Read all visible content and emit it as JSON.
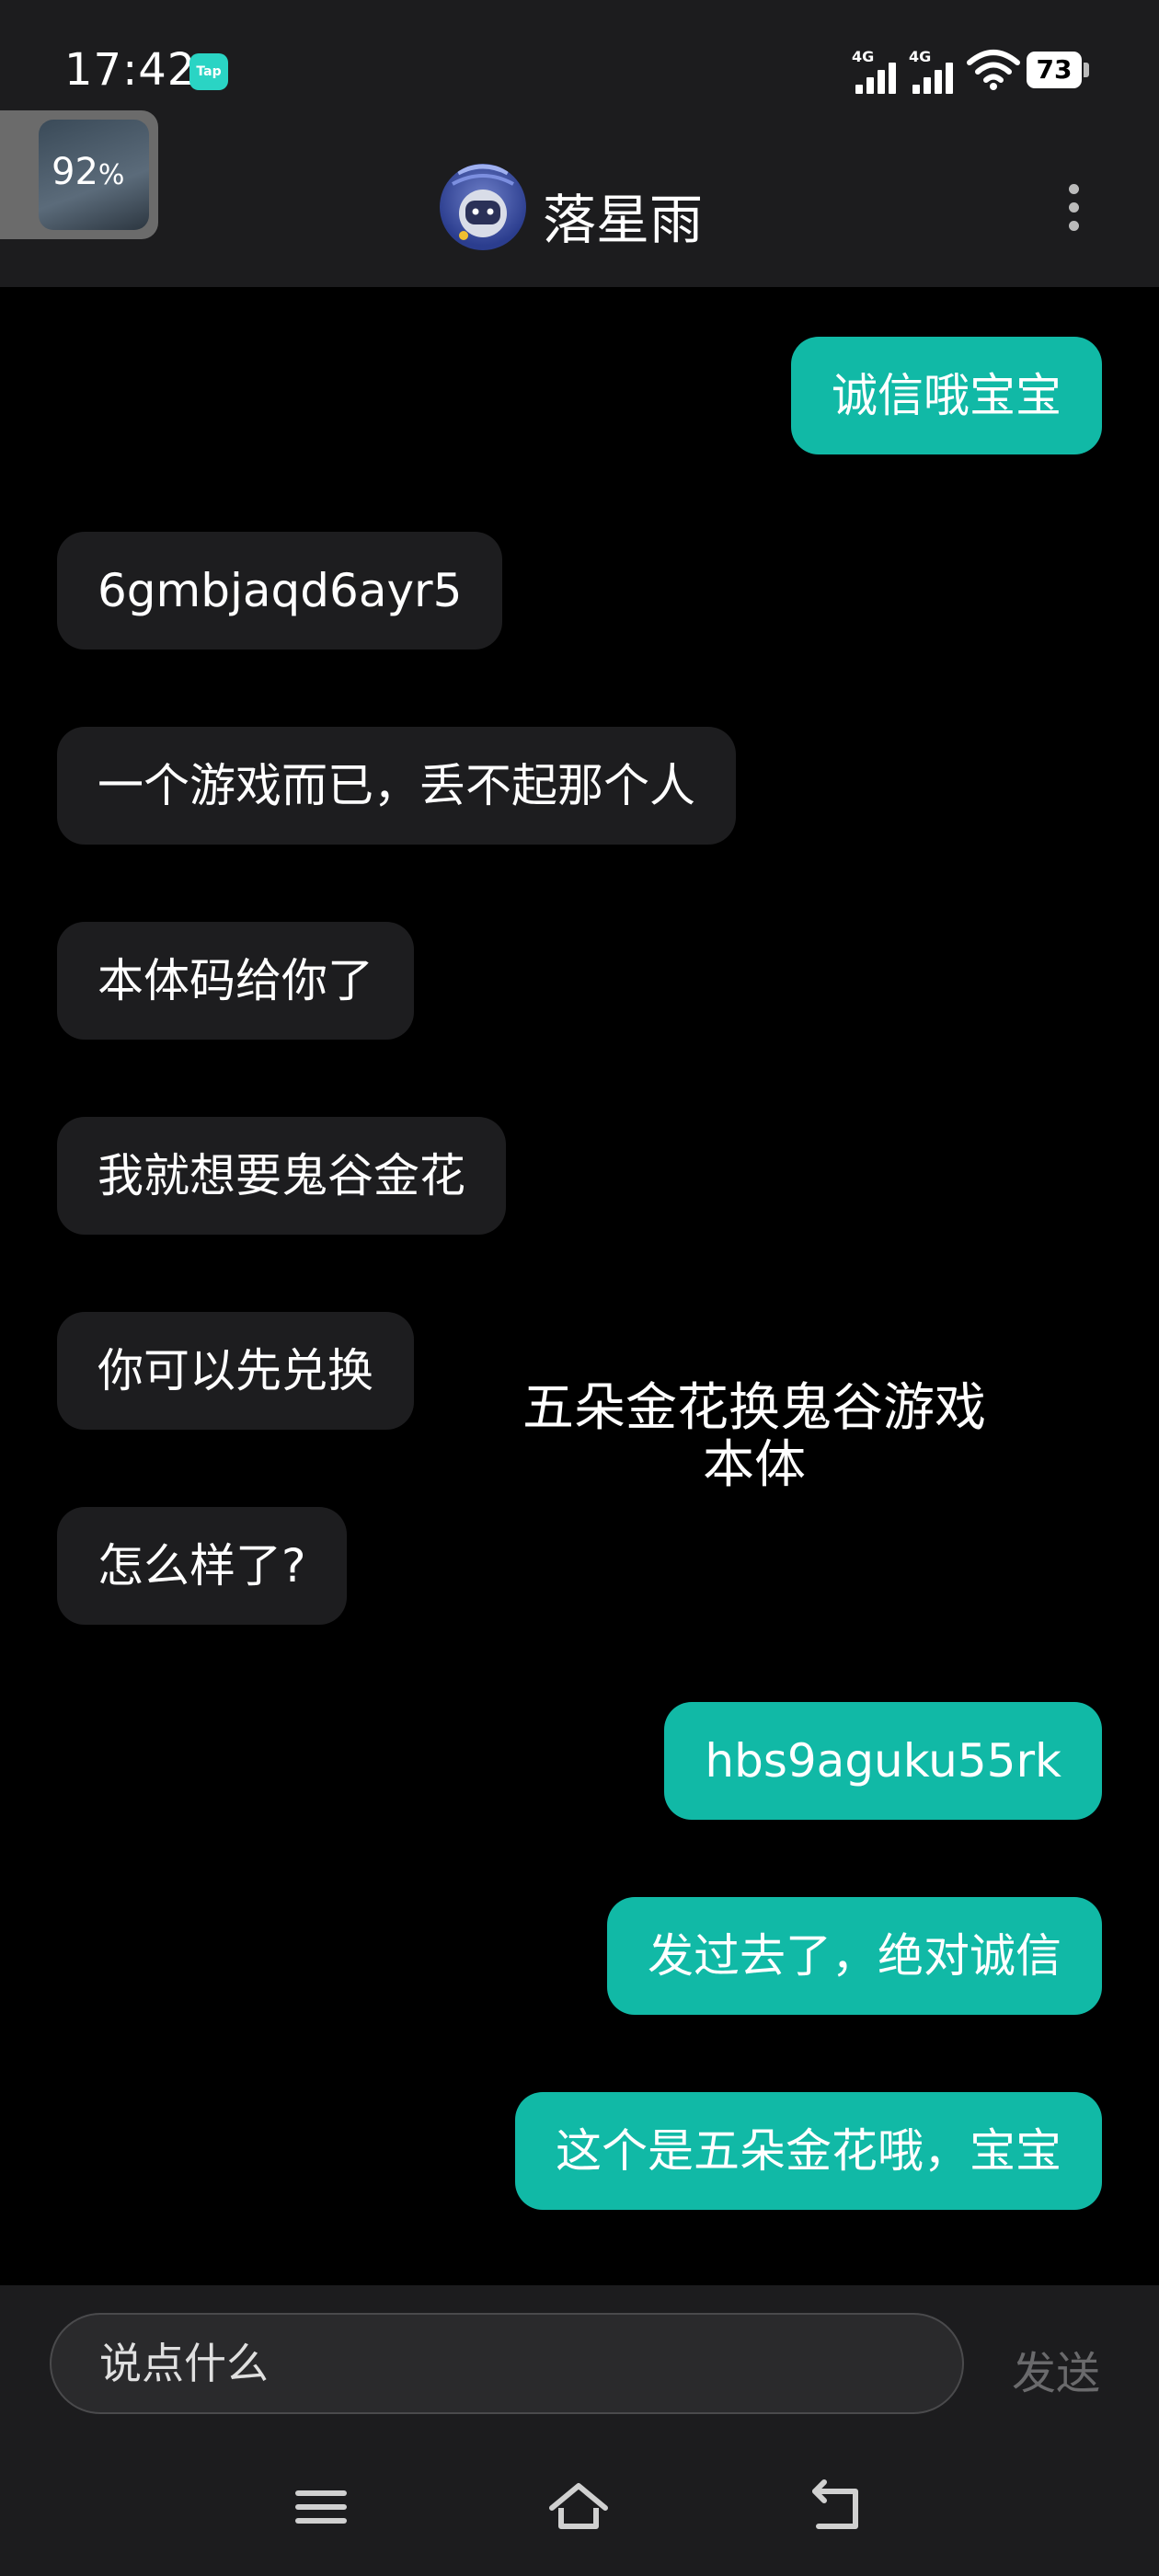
{
  "status_bar": {
    "time": "17:42",
    "app_badge": "Tap",
    "signal_1_label": "4G",
    "signal_2_label": "4G",
    "battery": "73"
  },
  "floating_window": {
    "percent": "92",
    "percent_sign": "%"
  },
  "header": {
    "contact_name": "落星雨"
  },
  "messages": [
    {
      "text": "诚信哦宝宝",
      "direction": "outgoing"
    },
    {
      "text": "6gmbjaqd6ayr5",
      "direction": "incoming"
    },
    {
      "text": "一个游戏而已，丢不起那个人",
      "direction": "incoming"
    },
    {
      "text": "本体码给你了",
      "direction": "incoming"
    },
    {
      "text": "我就想要鬼谷金花",
      "direction": "incoming"
    },
    {
      "text": "你可以先兑换",
      "direction": "incoming"
    },
    {
      "text": "怎么样了?",
      "direction": "incoming"
    },
    {
      "text": "hbs9aguku55rk",
      "direction": "outgoing"
    },
    {
      "text": "发过去了，绝对诚信",
      "direction": "outgoing"
    },
    {
      "text": "这个是五朵金花哦，宝宝",
      "direction": "outgoing"
    }
  ],
  "overlay": {
    "line1": "五朵金花换鬼谷游戏",
    "line2": "本体"
  },
  "input": {
    "placeholder": "说点什么",
    "send_label": "发送"
  },
  "colors": {
    "outgoing_bubble": "#11b9a6",
    "incoming_bubble": "#1d1d1f",
    "background": "#000000",
    "bar_background": "#1c1c1e"
  }
}
